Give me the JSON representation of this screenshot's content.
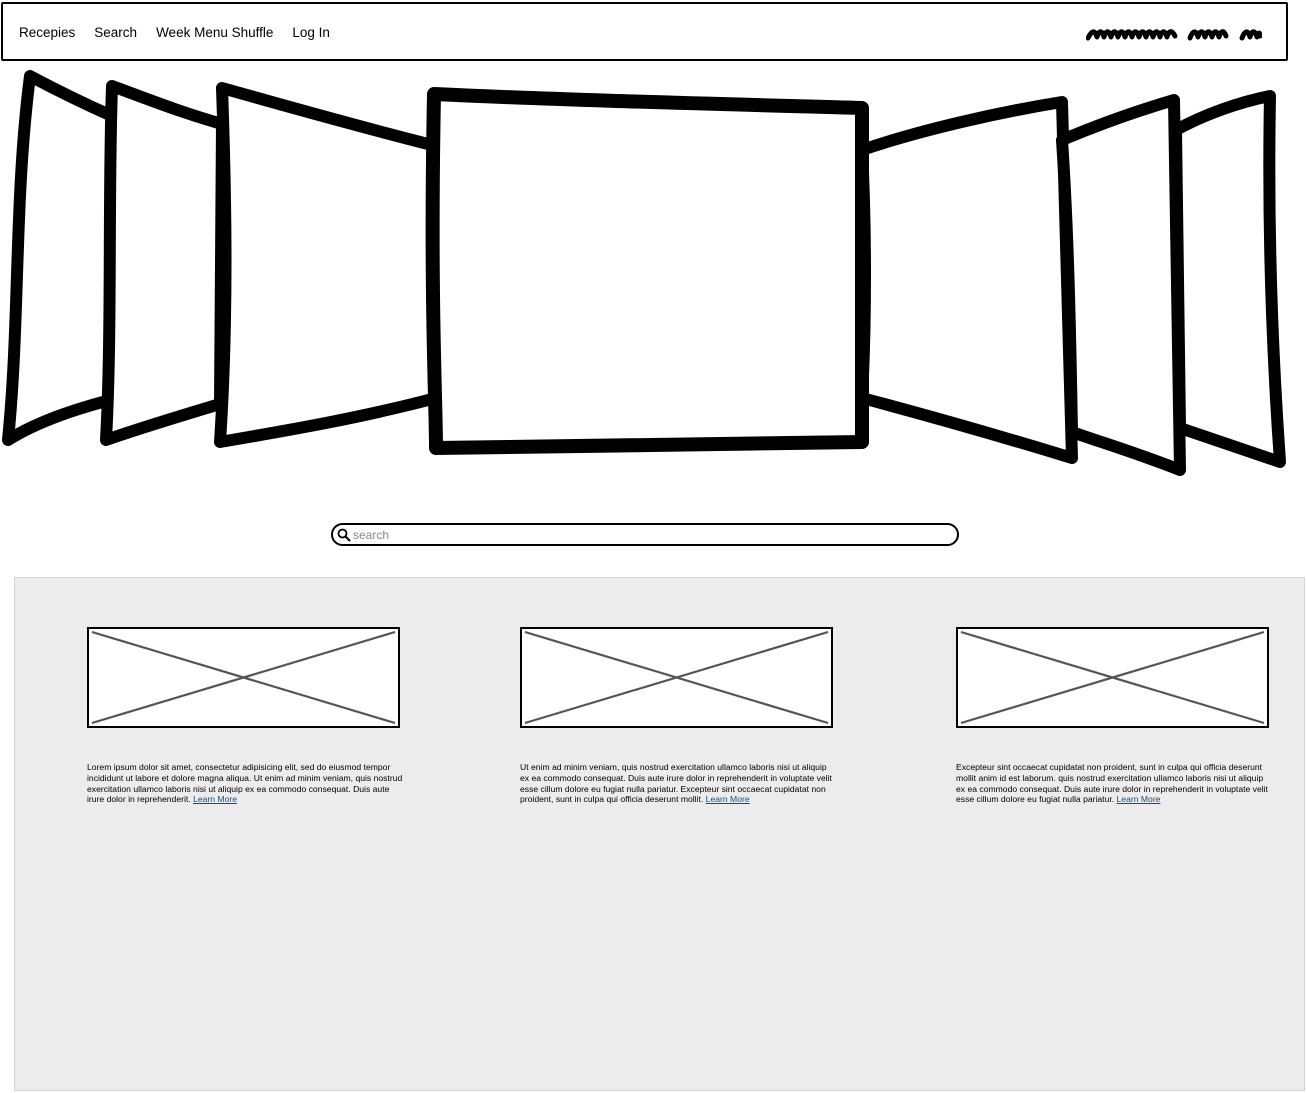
{
  "nav": {
    "links": [
      {
        "label": "Recepies"
      },
      {
        "label": "Search"
      },
      {
        "label": "Week Menu Shuffle"
      },
      {
        "label": "Log In"
      }
    ],
    "logo_icon": "scribble-logo-icon"
  },
  "carousel": {
    "slides_count": 7,
    "active_slide": 4
  },
  "search": {
    "placeholder": "search",
    "value": "",
    "icon": "search-icon"
  },
  "cards": [
    {
      "text": "Lorem ipsum dolor sit amet, consectetur adipisicing elit, sed do eiusmod tempor incididunt ut labore et dolore magna aliqua. Ut enim ad minim veniam, quis nostrud exercitation ullamco laboris nisi ut aliquip ex ea commodo consequat. Duis aute irure dolor in reprehenderit.",
      "link": "Learn More"
    },
    {
      "text": "Ut enim ad minim veniam, quis nostrud exercitation ullamco laboris nisi ut aliquip ex ea commodo consequat. Duis aute irure dolor in reprehenderit in voluptate velit esse cillum dolore eu fugiat nulla pariatur. Excepteur sint occaecat cupidatat non proident, sunt in culpa qui officia deserunt mollit.",
      "link": "Learn More"
    },
    {
      "text": "Excepteur sint occaecat cupidatat non proident, sunt in culpa qui officia deserunt mollit anim id est laborum. quis nostrud exercitation ullamco laboris nisi ut aliquip ex ea commodo consequat. Duis aute irure dolor in reprehenderit in voluptate velit esse cillum dolore eu fugiat nulla pariatur.",
      "link": "Learn More"
    }
  ],
  "colors": {
    "panel_bg": "#ececec",
    "link": "#0b4f8a",
    "placeholder": "#8a8a8a"
  }
}
